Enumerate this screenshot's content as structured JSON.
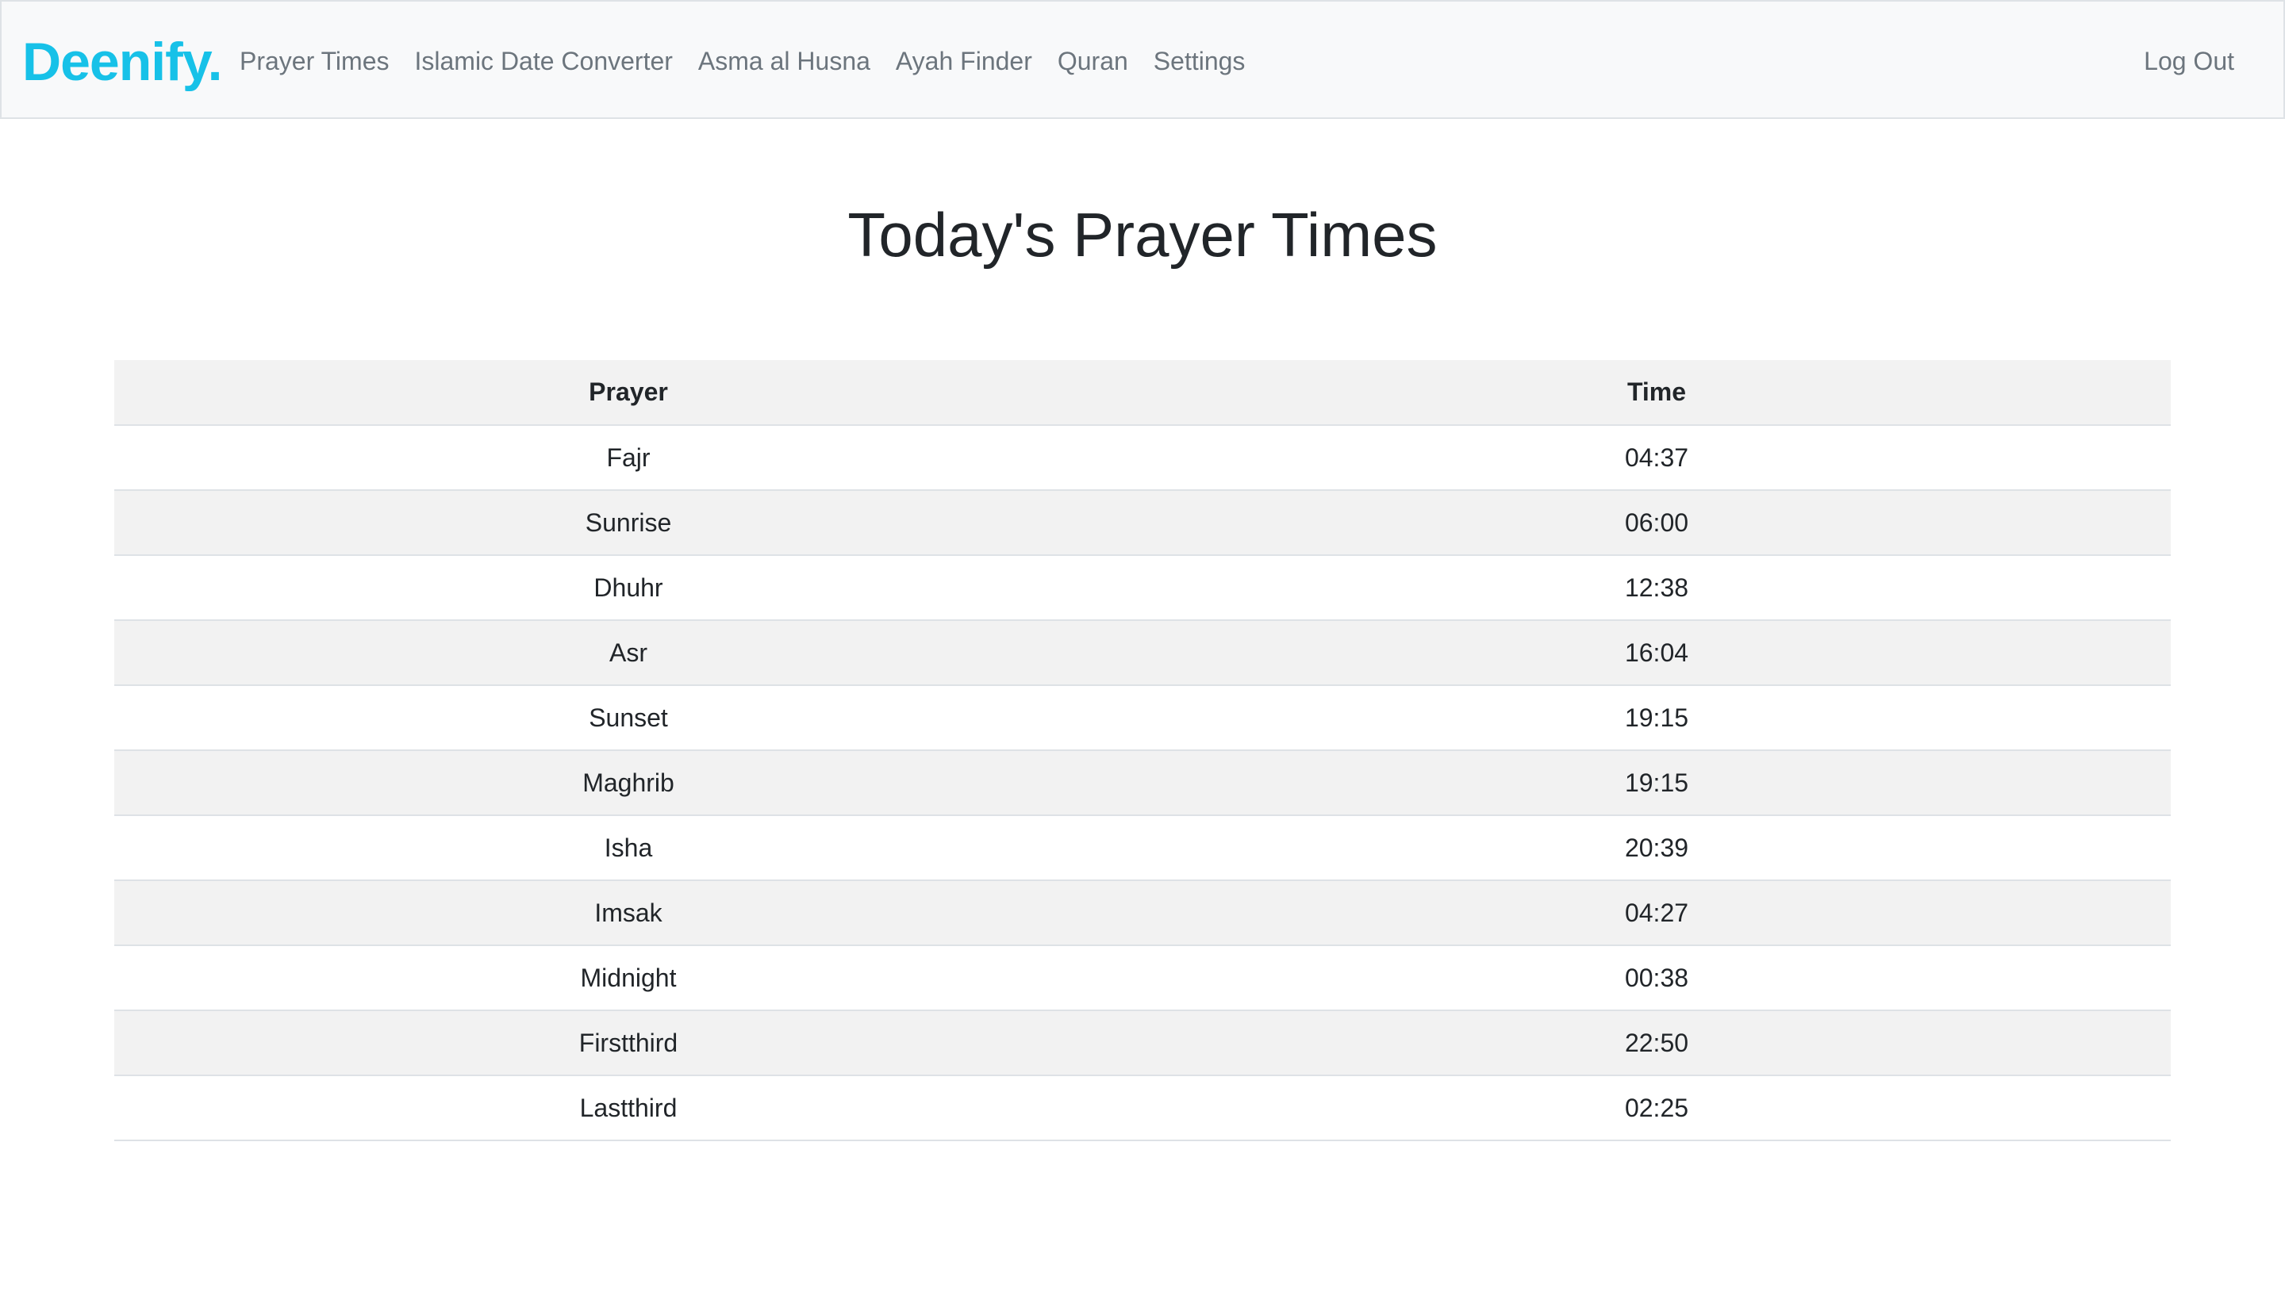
{
  "navbar": {
    "brand": "Deenify.",
    "links": [
      {
        "label": "Prayer Times"
      },
      {
        "label": "Islamic Date Converter"
      },
      {
        "label": "Asma al Husna"
      },
      {
        "label": "Ayah Finder"
      },
      {
        "label": "Quran"
      },
      {
        "label": "Settings"
      }
    ],
    "logout": "Log Out"
  },
  "main": {
    "title": "Today's Prayer Times",
    "table": {
      "headers": [
        "Prayer",
        "Time"
      ],
      "rows": [
        {
          "prayer": "Fajr",
          "time": "04:37"
        },
        {
          "prayer": "Sunrise",
          "time": "06:00"
        },
        {
          "prayer": "Dhuhr",
          "time": "12:38"
        },
        {
          "prayer": "Asr",
          "time": "16:04"
        },
        {
          "prayer": "Sunset",
          "time": "19:15"
        },
        {
          "prayer": "Maghrib",
          "time": "19:15"
        },
        {
          "prayer": "Isha",
          "time": "20:39"
        },
        {
          "prayer": "Imsak",
          "time": "04:27"
        },
        {
          "prayer": "Midnight",
          "time": "00:38"
        },
        {
          "prayer": "Firstthird",
          "time": "22:50"
        },
        {
          "prayer": "Lastthird",
          "time": "02:25"
        }
      ]
    }
  },
  "colors": {
    "brand": "#17c1e8",
    "navbar_bg": "#f8f9fa",
    "stripe": "#f2f2f2"
  }
}
